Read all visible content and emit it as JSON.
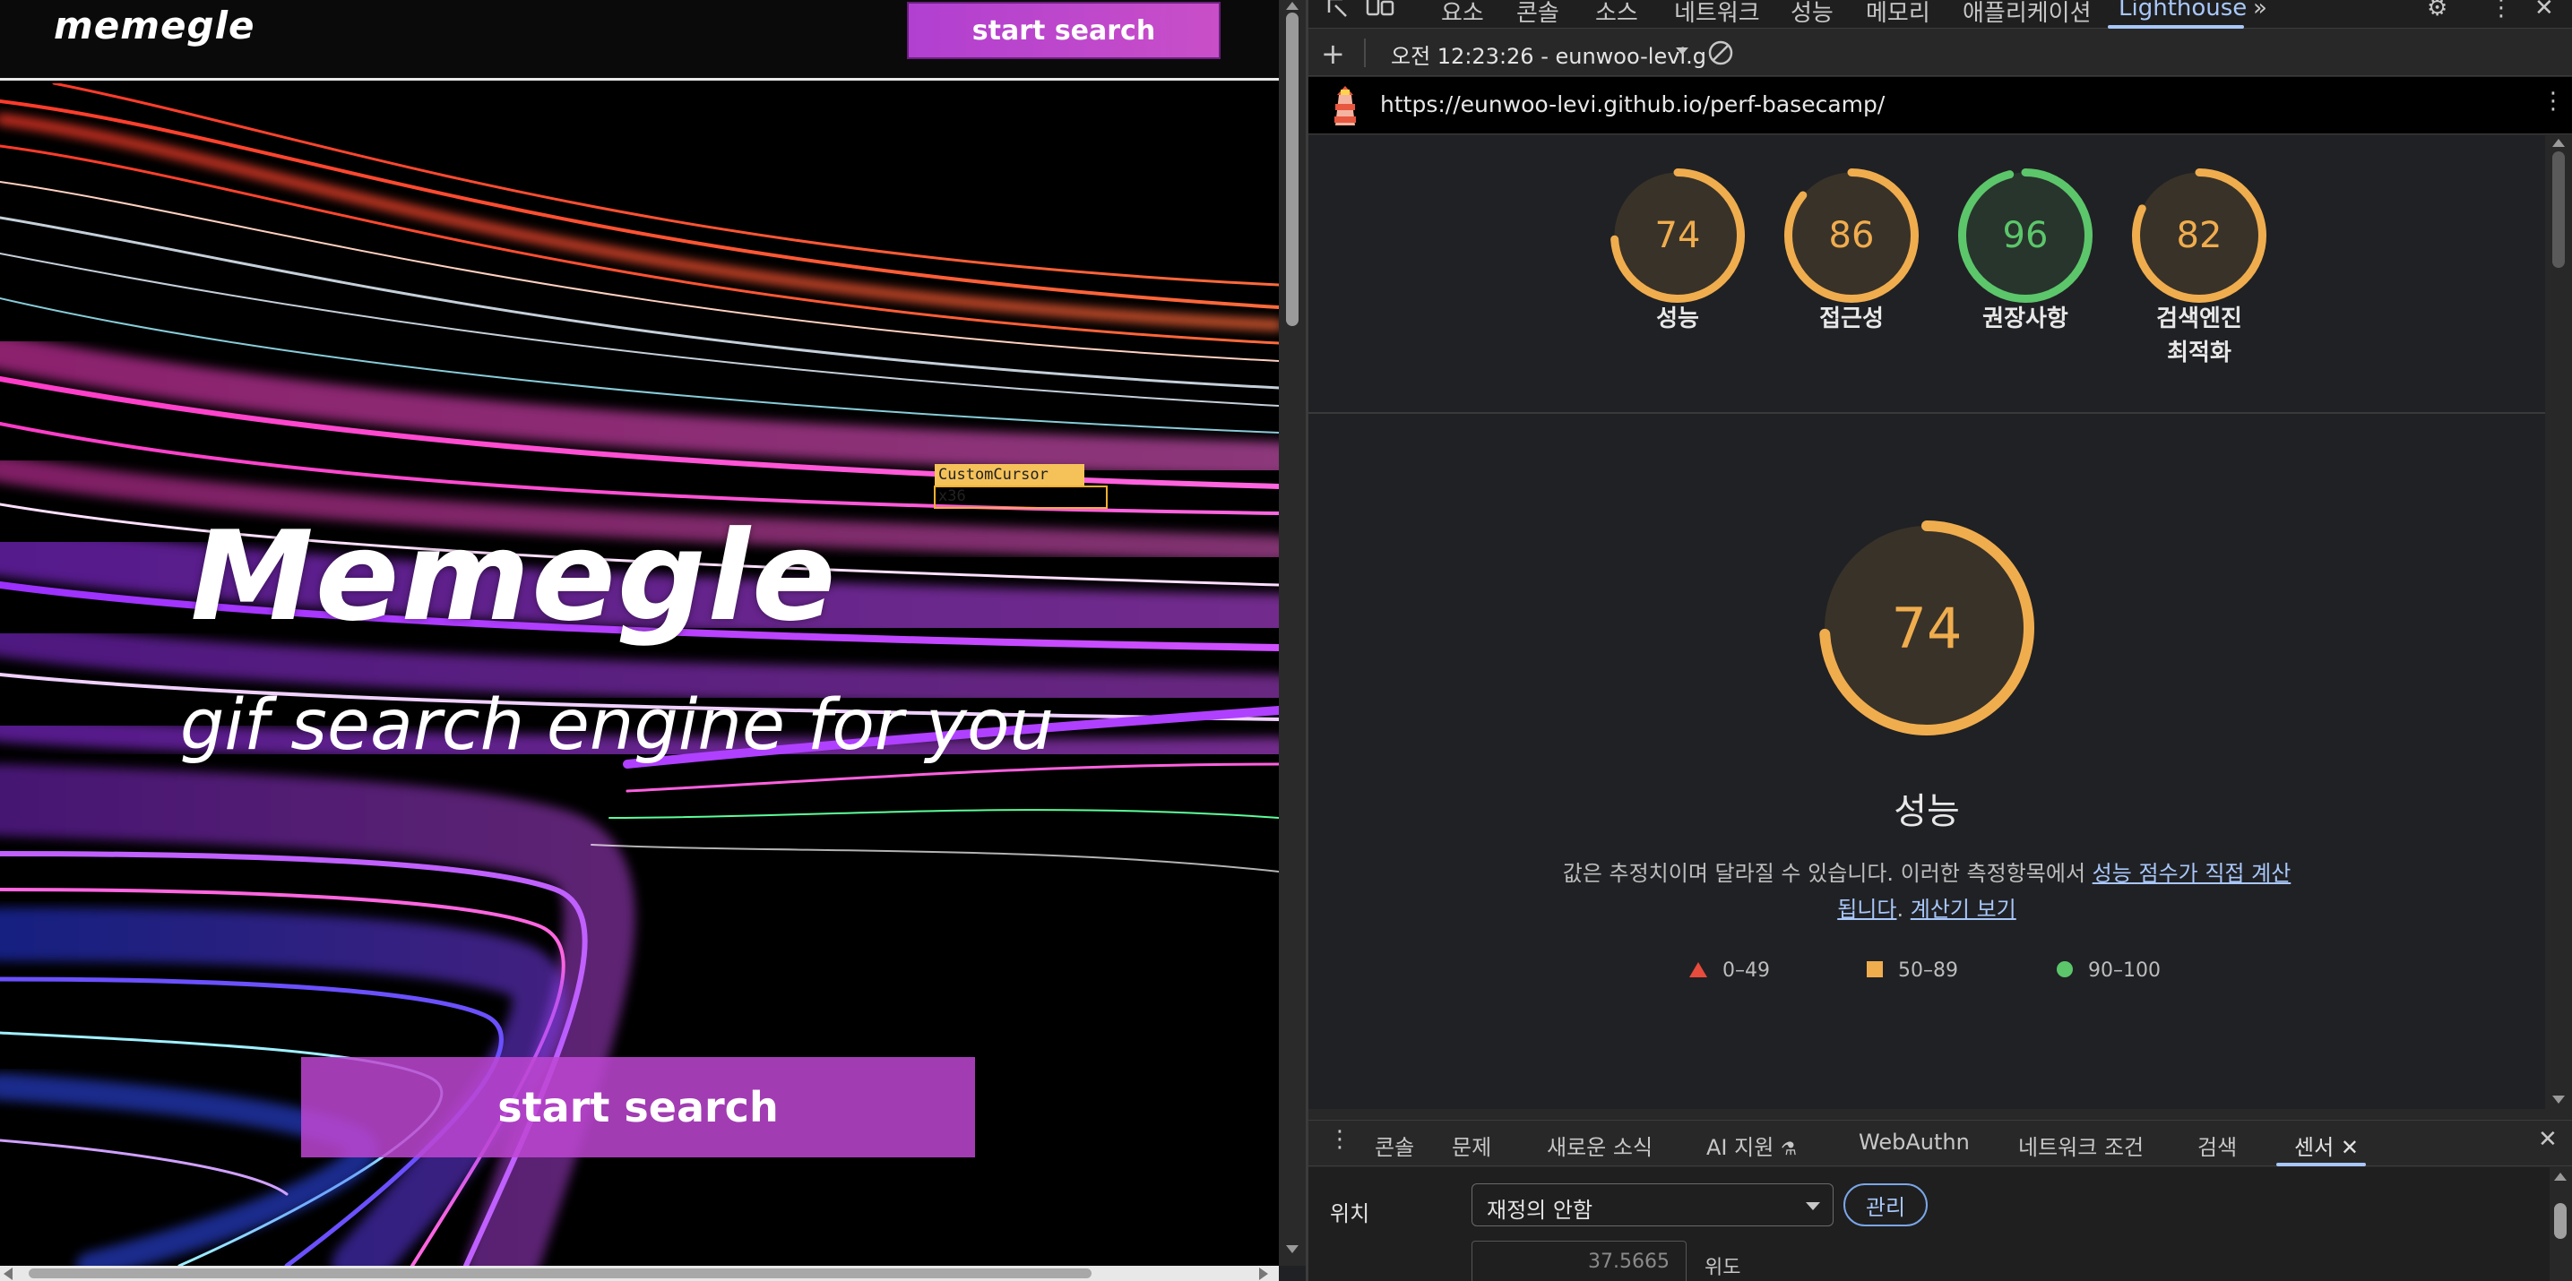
{
  "page": {
    "logo": "memegle",
    "nav_button": "start search",
    "hero_title": "Memegle",
    "hero_subtitle": "gif search engine for you",
    "hero_button": "start search",
    "cursor_tag": "CustomCursor x36"
  },
  "devtools": {
    "tabs": [
      "요소",
      "콘솔",
      "소스",
      "네트워크",
      "성능",
      "메모리",
      "애플리케이션",
      "Lighthouse"
    ],
    "active_tab": "Lighthouse",
    "more_tabs_icon": "double-chevron-right",
    "report_selector": "오전 12:23:26 - eunwoo-levi.g",
    "report_url": "https://eunwoo-levi.github.io/perf-basecamp/",
    "scores": [
      {
        "label": "성능",
        "value": "74",
        "color": "#f0ad4e",
        "fraction": 0.74
      },
      {
        "label": "접근성",
        "value": "86",
        "color": "#f0ad4e",
        "fraction": 0.86
      },
      {
        "label": "권장사항",
        "value": "96",
        "color": "#5cc66b",
        "fraction": 0.96
      },
      {
        "label": "검색엔진\n최적화",
        "label_line1": "검색엔진",
        "label_line2": "최적화",
        "value": "82",
        "color": "#f0ad4e",
        "fraction": 0.82
      }
    ],
    "main_score": {
      "value": "74",
      "fraction": 0.74,
      "color": "#f0ad4e",
      "title": "성능"
    },
    "description_prefix": "값은 추정치이며 달라질 수 있습니다. 이러한 측정항목에서 ",
    "description_link1_line1": "성능 점수가 직접 계산",
    "description_link1_line2": "됩니다",
    "description_sep": ". ",
    "description_link2": "계산기 보기",
    "legend": [
      {
        "shape": "triangle",
        "range": "0–49",
        "color": "#e74c3c"
      },
      {
        "shape": "square",
        "range": "50–89",
        "color": "#f0ad4e"
      },
      {
        "shape": "circle",
        "range": "90–100",
        "color": "#5cc66b"
      }
    ],
    "drawer_tabs": [
      "콘솔",
      "문제",
      "새로운 소식",
      "AI 지원",
      "WebAuthn",
      "네트워크 조건",
      "검색",
      "센서"
    ],
    "drawer_active": "센서",
    "sensors": {
      "location_label": "위치",
      "location_value": "재정의 안함",
      "manage_button": "관리",
      "latitude_value": "37.5665",
      "latitude_label": "위도"
    }
  }
}
